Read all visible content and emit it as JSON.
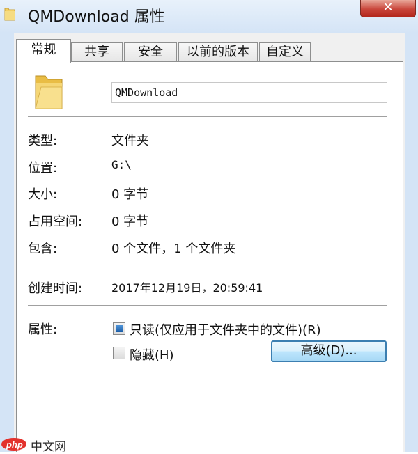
{
  "window": {
    "title": "QMDownload 属性",
    "close_label": "✕"
  },
  "tabs": [
    {
      "label": "常规",
      "active": true
    },
    {
      "label": "共享",
      "active": false
    },
    {
      "label": "安全",
      "active": false
    },
    {
      "label": "以前的版本",
      "active": false
    },
    {
      "label": "自定义",
      "active": false
    }
  ],
  "general": {
    "folder_name": "QMDownload",
    "type_label": "类型:",
    "type_value": "文件夹",
    "location_label": "位置:",
    "location_value": "G:\\",
    "size_label": "大小:",
    "size_value": "0 字节",
    "size_on_disk_label": "占用空间:",
    "size_on_disk_value": "0 字节",
    "contains_label": "包含:",
    "contains_value": "0 个文件，1 个文件夹",
    "created_label": "创建时间:",
    "created_value": "2017年12月19日，20:59:41",
    "attributes_label": "属性:",
    "readonly_label": "只读(仅应用于文件夹中的文件)(R)",
    "readonly_state": "indeterminate",
    "hidden_label": "隐藏(H)",
    "hidden_checked": false,
    "advanced_button": "高级(D)..."
  },
  "watermark": {
    "text": "中文网"
  },
  "icons": {
    "title_icon": "folder-icon",
    "folder_icon": "folder-icon",
    "watermark_logo": "php-logo"
  }
}
